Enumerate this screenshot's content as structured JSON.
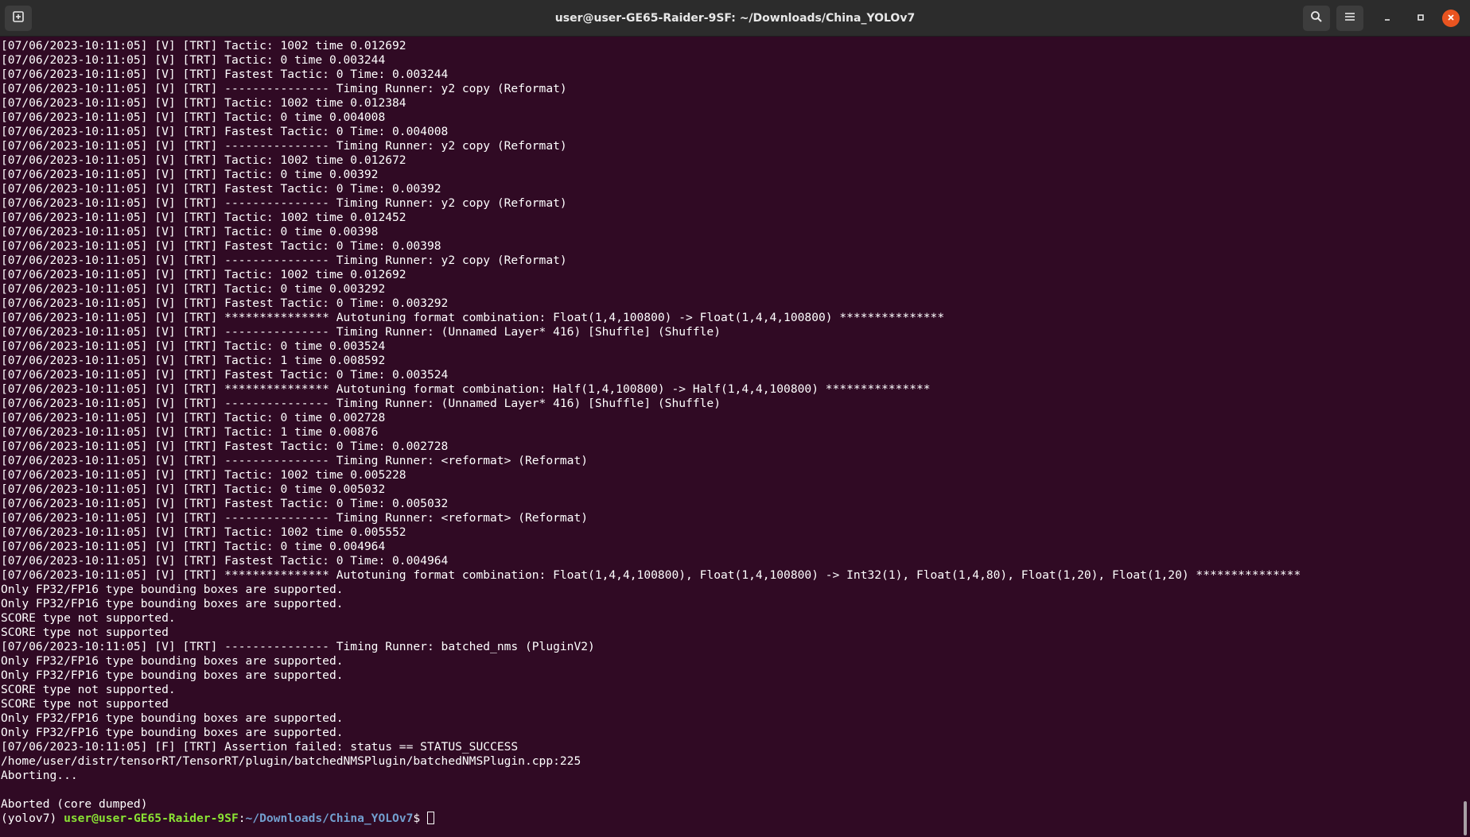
{
  "window": {
    "title": "user@user-GE65-Raider-9SF: ~/Downloads/China_YOLOv7"
  },
  "icons": {
    "new_tab": "new-tab-icon",
    "search": "search-icon",
    "menu": "hamburger-menu-icon",
    "minimize": "minimize-icon",
    "maximize": "maximize-icon",
    "close": "close-icon"
  },
  "colors": {
    "terminal_bg": "#300a24",
    "titlebar_bg": "#2c2c2c",
    "prompt_user": "#8ae234",
    "prompt_path": "#729fcf",
    "close_button": "#e95420"
  },
  "terminal": {
    "lines": [
      "[07/06/2023-10:11:05] [V] [TRT] Tactic: 1002 time 0.012692",
      "[07/06/2023-10:11:05] [V] [TRT] Tactic: 0 time 0.003244",
      "[07/06/2023-10:11:05] [V] [TRT] Fastest Tactic: 0 Time: 0.003244",
      "[07/06/2023-10:11:05] [V] [TRT] --------------- Timing Runner: y2 copy (Reformat)",
      "[07/06/2023-10:11:05] [V] [TRT] Tactic: 1002 time 0.012384",
      "[07/06/2023-10:11:05] [V] [TRT] Tactic: 0 time 0.004008",
      "[07/06/2023-10:11:05] [V] [TRT] Fastest Tactic: 0 Time: 0.004008",
      "[07/06/2023-10:11:05] [V] [TRT] --------------- Timing Runner: y2 copy (Reformat)",
      "[07/06/2023-10:11:05] [V] [TRT] Tactic: 1002 time 0.012672",
      "[07/06/2023-10:11:05] [V] [TRT] Tactic: 0 time 0.00392",
      "[07/06/2023-10:11:05] [V] [TRT] Fastest Tactic: 0 Time: 0.00392",
      "[07/06/2023-10:11:05] [V] [TRT] --------------- Timing Runner: y2 copy (Reformat)",
      "[07/06/2023-10:11:05] [V] [TRT] Tactic: 1002 time 0.012452",
      "[07/06/2023-10:11:05] [V] [TRT] Tactic: 0 time 0.00398",
      "[07/06/2023-10:11:05] [V] [TRT] Fastest Tactic: 0 Time: 0.00398",
      "[07/06/2023-10:11:05] [V] [TRT] --------------- Timing Runner: y2 copy (Reformat)",
      "[07/06/2023-10:11:05] [V] [TRT] Tactic: 1002 time 0.012692",
      "[07/06/2023-10:11:05] [V] [TRT] Tactic: 0 time 0.003292",
      "[07/06/2023-10:11:05] [V] [TRT] Fastest Tactic: 0 Time: 0.003292",
      "[07/06/2023-10:11:05] [V] [TRT] *************** Autotuning format combination: Float(1,4,100800) -> Float(1,4,4,100800) ***************",
      "[07/06/2023-10:11:05] [V] [TRT] --------------- Timing Runner: (Unnamed Layer* 416) [Shuffle] (Shuffle)",
      "[07/06/2023-10:11:05] [V] [TRT] Tactic: 0 time 0.003524",
      "[07/06/2023-10:11:05] [V] [TRT] Tactic: 1 time 0.008592",
      "[07/06/2023-10:11:05] [V] [TRT] Fastest Tactic: 0 Time: 0.003524",
      "[07/06/2023-10:11:05] [V] [TRT] *************** Autotuning format combination: Half(1,4,100800) -> Half(1,4,4,100800) ***************",
      "[07/06/2023-10:11:05] [V] [TRT] --------------- Timing Runner: (Unnamed Layer* 416) [Shuffle] (Shuffle)",
      "[07/06/2023-10:11:05] [V] [TRT] Tactic: 0 time 0.002728",
      "[07/06/2023-10:11:05] [V] [TRT] Tactic: 1 time 0.00876",
      "[07/06/2023-10:11:05] [V] [TRT] Fastest Tactic: 0 Time: 0.002728",
      "[07/06/2023-10:11:05] [V] [TRT] --------------- Timing Runner: <reformat> (Reformat)",
      "[07/06/2023-10:11:05] [V] [TRT] Tactic: 1002 time 0.005228",
      "[07/06/2023-10:11:05] [V] [TRT] Tactic: 0 time 0.005032",
      "[07/06/2023-10:11:05] [V] [TRT] Fastest Tactic: 0 Time: 0.005032",
      "[07/06/2023-10:11:05] [V] [TRT] --------------- Timing Runner: <reformat> (Reformat)",
      "[07/06/2023-10:11:05] [V] [TRT] Tactic: 1002 time 0.005552",
      "[07/06/2023-10:11:05] [V] [TRT] Tactic: 0 time 0.004964",
      "[07/06/2023-10:11:05] [V] [TRT] Fastest Tactic: 0 Time: 0.004964",
      "[07/06/2023-10:11:05] [V] [TRT] *************** Autotuning format combination: Float(1,4,4,100800), Float(1,4,100800) -> Int32(1), Float(1,4,80), Float(1,20), Float(1,20) ***************",
      "Only FP32/FP16 type bounding boxes are supported.",
      "Only FP32/FP16 type bounding boxes are supported.",
      "SCORE type not supported.",
      "SCORE type not supported",
      "[07/06/2023-10:11:05] [V] [TRT] --------------- Timing Runner: batched_nms (PluginV2)",
      "Only FP32/FP16 type bounding boxes are supported.",
      "Only FP32/FP16 type bounding boxes are supported.",
      "SCORE type not supported.",
      "SCORE type not supported",
      "Only FP32/FP16 type bounding boxes are supported.",
      "Only FP32/FP16 type bounding boxes are supported.",
      "[07/06/2023-10:11:05] [F] [TRT] Assertion failed: status == STATUS_SUCCESS",
      "/home/user/distr/tensorRT/TensorRT/plugin/batchedNMSPlugin/batchedNMSPlugin.cpp:225",
      "Aborting...",
      "",
      "Aborted (core dumped)"
    ],
    "prompt": {
      "env": "(yolov7) ",
      "user_host": "user@user-GE65-Raider-9SF",
      "separator": ":",
      "path": "~/Downloads/China_YOLOv7",
      "symbol": "$"
    }
  }
}
